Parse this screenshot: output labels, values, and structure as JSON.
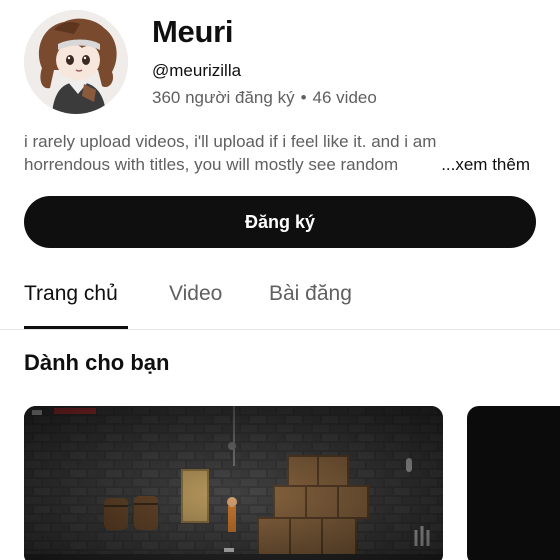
{
  "channel": {
    "name": "Meuri",
    "handle": "@meurizilla",
    "subscribers": "360 người đăng ký",
    "separator": "•",
    "videos": "46 video"
  },
  "description": {
    "line1": "i rarely upload videos, i'll upload if i feel like it. and i am",
    "line2": "horrendous with titles, you will mostly see random",
    "more_label": "...xem thêm"
  },
  "subscribe_label": "Đăng ký",
  "tabs": [
    {
      "label": "Trang chủ",
      "active": true
    },
    {
      "label": "Video",
      "active": false
    },
    {
      "label": "Bài đăng",
      "active": false
    }
  ],
  "section_title": "Dành cho bạn",
  "colors": {
    "primary_text": "#0f0f0f",
    "secondary_text": "#606060",
    "button_bg": "#0f0f0f",
    "button_text": "#ffffff"
  }
}
